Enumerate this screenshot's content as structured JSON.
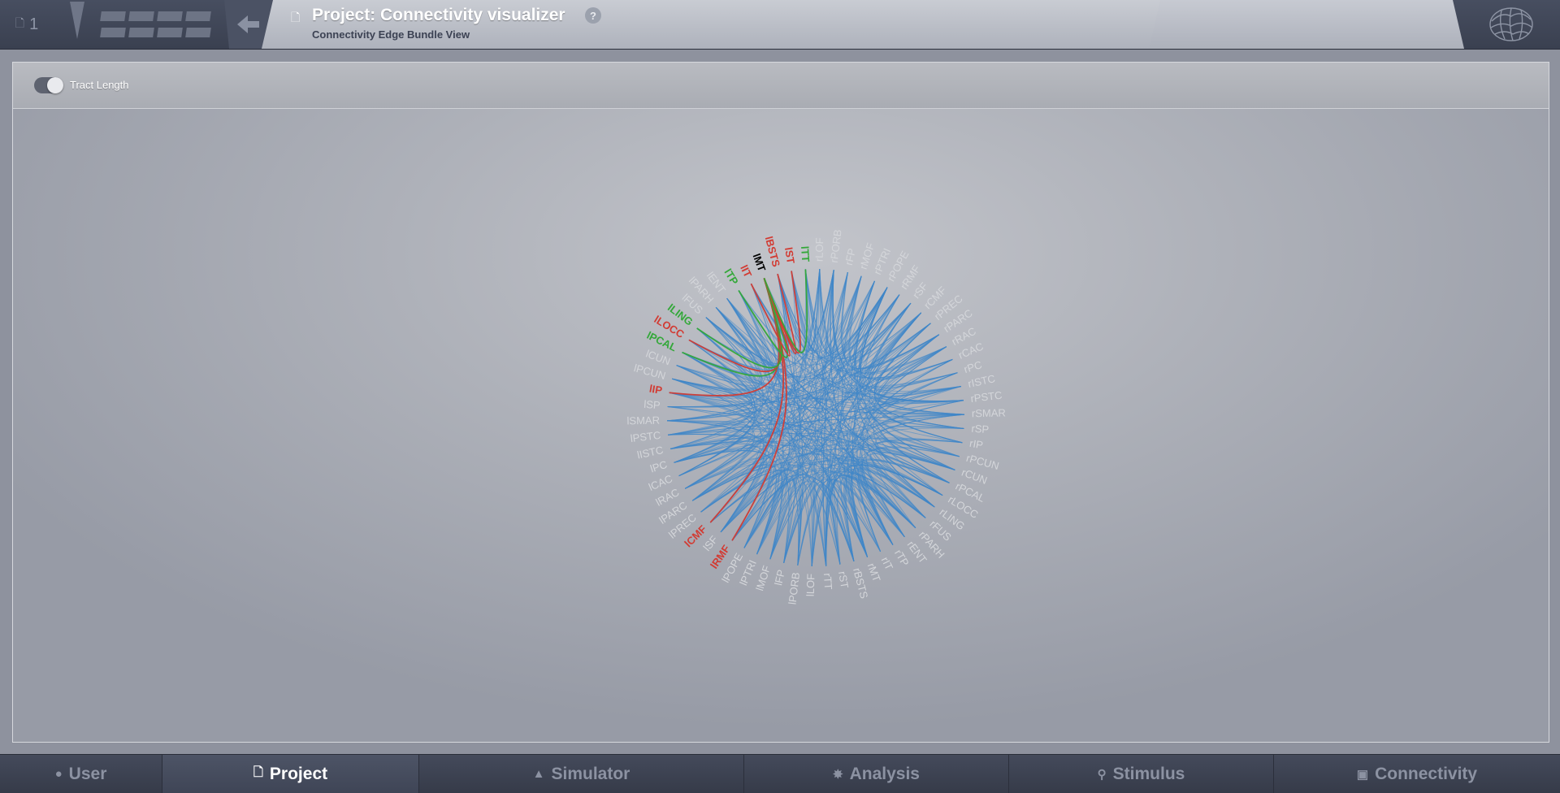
{
  "header": {
    "page_count": "1",
    "title": "Project: Connectivity visualizer",
    "help": "?",
    "subtitle": "Connectivity Edge Bundle View"
  },
  "toolbar": {
    "toggle_label": "Tract Length",
    "toggle_on": true
  },
  "bottom_nav": [
    {
      "label": "User",
      "icon": "user-icon",
      "active": false
    },
    {
      "label": "Project",
      "icon": "document-icon",
      "active": true
    },
    {
      "label": "Simulator",
      "icon": "rocket-icon",
      "active": false
    },
    {
      "label": "Analysis",
      "icon": "gear-icon",
      "active": false
    },
    {
      "label": "Stimulus",
      "icon": "pin-icon",
      "active": false
    },
    {
      "label": "Connectivity",
      "icon": "network-icon",
      "active": false
    }
  ],
  "colors": {
    "edge_default": "#3f86c9",
    "incoming": "#d23b33",
    "outgoing": "#33a839",
    "selected": "#000000",
    "node_label": "#d4d6da"
  },
  "chart_data": {
    "type": "chord",
    "selected_node": "lMT",
    "nodes": [
      {
        "label": "rLOF",
        "state": "default"
      },
      {
        "label": "rPORB",
        "state": "default"
      },
      {
        "label": "rFP",
        "state": "default"
      },
      {
        "label": "rMOF",
        "state": "default"
      },
      {
        "label": "rPTRI",
        "state": "default"
      },
      {
        "label": "rPOPE",
        "state": "default"
      },
      {
        "label": "rRMF",
        "state": "default"
      },
      {
        "label": "rSF",
        "state": "default"
      },
      {
        "label": "rCMF",
        "state": "default"
      },
      {
        "label": "rPREC",
        "state": "default"
      },
      {
        "label": "rPARC",
        "state": "default"
      },
      {
        "label": "rRAC",
        "state": "default"
      },
      {
        "label": "rCAC",
        "state": "default"
      },
      {
        "label": "rPC",
        "state": "default"
      },
      {
        "label": "rISTC",
        "state": "default"
      },
      {
        "label": "rPSTC",
        "state": "default"
      },
      {
        "label": "rSMAR",
        "state": "default"
      },
      {
        "label": "rSP",
        "state": "default"
      },
      {
        "label": "rIP",
        "state": "default"
      },
      {
        "label": "rPCUN",
        "state": "default"
      },
      {
        "label": "rCUN",
        "state": "default"
      },
      {
        "label": "rPCAL",
        "state": "default"
      },
      {
        "label": "rLOCC",
        "state": "default"
      },
      {
        "label": "rLING",
        "state": "default"
      },
      {
        "label": "rFUS",
        "state": "default"
      },
      {
        "label": "rPARH",
        "state": "default"
      },
      {
        "label": "rENT",
        "state": "default"
      },
      {
        "label": "rTP",
        "state": "default"
      },
      {
        "label": "rIT",
        "state": "default"
      },
      {
        "label": "rMT",
        "state": "default"
      },
      {
        "label": "rBSTS",
        "state": "default"
      },
      {
        "label": "rST",
        "state": "default"
      },
      {
        "label": "rTT",
        "state": "default"
      },
      {
        "label": "lLOF",
        "state": "default"
      },
      {
        "label": "lPORB",
        "state": "default"
      },
      {
        "label": "lFP",
        "state": "default"
      },
      {
        "label": "lMOF",
        "state": "default"
      },
      {
        "label": "lPTRI",
        "state": "default"
      },
      {
        "label": "lPOPE",
        "state": "default"
      },
      {
        "label": "lRMF",
        "state": "incoming"
      },
      {
        "label": "lSF",
        "state": "default"
      },
      {
        "label": "lCMF",
        "state": "incoming"
      },
      {
        "label": "lPREC",
        "state": "default"
      },
      {
        "label": "lPARC",
        "state": "default"
      },
      {
        "label": "lRAC",
        "state": "default"
      },
      {
        "label": "lCAC",
        "state": "default"
      },
      {
        "label": "lPC",
        "state": "default"
      },
      {
        "label": "lISTC",
        "state": "default"
      },
      {
        "label": "lPSTC",
        "state": "default"
      },
      {
        "label": "lSMAR",
        "state": "default"
      },
      {
        "label": "lSP",
        "state": "default"
      },
      {
        "label": "lIP",
        "state": "incoming"
      },
      {
        "label": "lPCUN",
        "state": "default"
      },
      {
        "label": "lCUN",
        "state": "default"
      },
      {
        "label": "lPCAL",
        "state": "outgoing"
      },
      {
        "label": "lLOCC",
        "state": "incoming"
      },
      {
        "label": "lLING",
        "state": "outgoing"
      },
      {
        "label": "lFUS",
        "state": "default"
      },
      {
        "label": "lPARH",
        "state": "default"
      },
      {
        "label": "lENT",
        "state": "default"
      },
      {
        "label": "lTP",
        "state": "outgoing"
      },
      {
        "label": "lIT",
        "state": "incoming"
      },
      {
        "label": "lMT",
        "state": "selected"
      },
      {
        "label": "lBSTS",
        "state": "incoming"
      },
      {
        "label": "lST",
        "state": "incoming"
      },
      {
        "label": "lTT",
        "state": "outgoing"
      }
    ]
  }
}
